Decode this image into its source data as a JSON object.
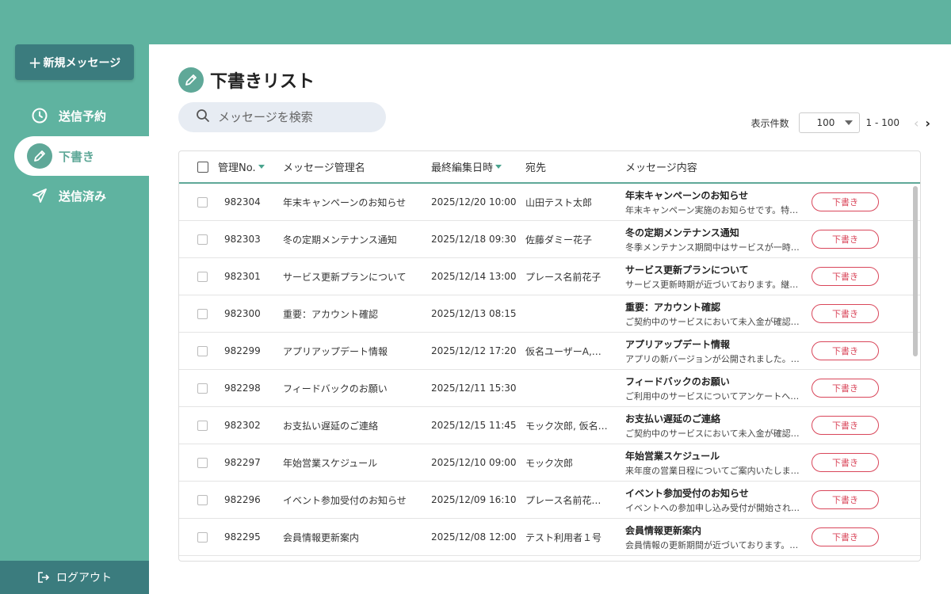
{
  "sidebar": {
    "new_message": "新規メッセージ",
    "items": [
      {
        "label": "送信予約",
        "icon": "clock-icon"
      },
      {
        "label": "下書き",
        "icon": "pencil-icon"
      },
      {
        "label": "送信済み",
        "icon": "send-icon"
      }
    ],
    "logout": "ログアウト"
  },
  "main": {
    "title": "下書きリスト",
    "search_placeholder": "メッセージを検索",
    "pager": {
      "label": "表示件数",
      "per_page": "100",
      "range": "1 - 100"
    },
    "columns": {
      "no": "管理No.",
      "name": "メッセージ管理名",
      "date": "最終編集日時",
      "to": "宛先",
      "content": "メッセージ内容"
    },
    "rows": [
      {
        "no": "982304",
        "name": "年末キャンペーンのお知らせ",
        "date": "2025/12/20 10:00",
        "to": "山田テスト太郎",
        "title": "年末キャンペーンのお知らせ",
        "body": "年末キャンペーン実施のお知らせです。特…",
        "status": "下書き"
      },
      {
        "no": "982303",
        "name": "冬の定期メンテナンス通知",
        "date": "2025/12/18 09:30",
        "to": "佐藤ダミー花子",
        "title": "冬の定期メンテナンス通知",
        "body": "冬季メンテナンス期間中はサービスが一時…",
        "status": "下書き"
      },
      {
        "no": "982301",
        "name": "サービス更新プランについて",
        "date": "2025/12/14 13:00",
        "to": "プレース名前花子",
        "title": "サービス更新プランについて",
        "body": "サービス更新時期が近づいております。継…",
        "status": "下書き"
      },
      {
        "no": "982300",
        "name": "重要：アカウント確認",
        "date": "2025/12/13 08:15",
        "to": "",
        "title": "重要：アカウント確認",
        "body": "ご契約中のサービスにおいて未入金が確認…",
        "status": "下書き"
      },
      {
        "no": "982299",
        "name": "アプリアップデート情報",
        "date": "2025/12/12 17:20",
        "to": "仮名ユーザーA,…",
        "title": "アプリアップデート情報",
        "body": "アプリの新バージョンが公開されました。…",
        "status": "下書き"
      },
      {
        "no": "982298",
        "name": "フィードバックのお願い",
        "date": "2025/12/11 15:30",
        "to": "",
        "title": "フィードバックのお願い",
        "body": "ご利用中のサービスについてアンケートへ…",
        "status": "下書き"
      },
      {
        "no": "982302",
        "name": "お支払い遅延のご連絡",
        "date": "2025/12/15 11:45",
        "to": "モック次郎, 仮名…",
        "title": "お支払い遅延のご連絡",
        "body": "ご契約中のサービスにおいて未入金が確認…",
        "status": "下書き"
      },
      {
        "no": "982297",
        "name": "年始営業スケジュール",
        "date": "2025/12/10 09:00",
        "to": "モック次郎",
        "title": "年始営業スケジュール",
        "body": "来年度の営業日程についてご案内いたしま…",
        "status": "下書き"
      },
      {
        "no": "982296",
        "name": "イベント参加受付のお知らせ",
        "date": "2025/12/09 16:10",
        "to": "プレース名前花…",
        "title": "イベント参加受付のお知らせ",
        "body": "イベントへの参加申し込み受付が開始され…",
        "status": "下書き"
      },
      {
        "no": "982295",
        "name": "会員情報更新案内",
        "date": "2025/12/08 12:00",
        "to": "テスト利用者１号",
        "title": "会員情報更新案内",
        "body": "会員情報の更新期間が近づいております。…",
        "status": "下書き"
      }
    ]
  },
  "colors": {
    "accent": "#5fb3a0",
    "dark": "#3b7c7e",
    "draft": "#d9465a"
  }
}
